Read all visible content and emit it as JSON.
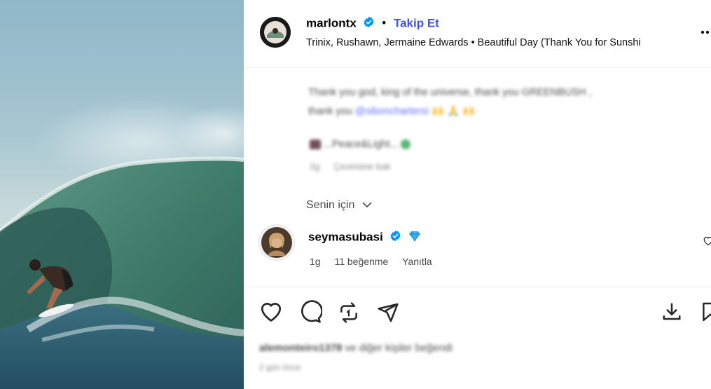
{
  "post": {
    "username": "marlontx",
    "separator": "•",
    "follow_label": "Takip Et",
    "audio": "Trinix, Rushawn, Jermaine Edwards • Beautiful Day (Thank You for Sunshi",
    "more_icon": "more-horizontal-icon"
  },
  "caption": {
    "line1": "Thank you god, king of the universe, thank you GREENBUSH ,",
    "line2_prefix": "thank you ",
    "mention": "@sibonchartersi",
    "emojis": "🙌 🙏 🙌",
    "line3_text": "...Peace&Light...",
    "time": "2g",
    "translate": "Çevirisine bak"
  },
  "for_you_label": "Senin için",
  "comment": {
    "username": "seymasubasi",
    "time": "1g",
    "likes": "11 beğenme",
    "reply": "Yanıtla"
  },
  "actions": {
    "like_icon": "heart-icon",
    "comment_icon": "comment-bubble-icon",
    "repost_icon": "repost-icon",
    "share_icon": "send-icon",
    "download_icon": "download-icon",
    "save_icon": "bookmark-icon"
  },
  "likes_line": {
    "user": "alemonteiro1378",
    "rest": "ve diğer kişiler beğendi"
  },
  "timestamp": "2 gün önce",
  "colors": {
    "link": "#4150f7",
    "verified": "#0095f6",
    "text_secondary": "#737373"
  }
}
